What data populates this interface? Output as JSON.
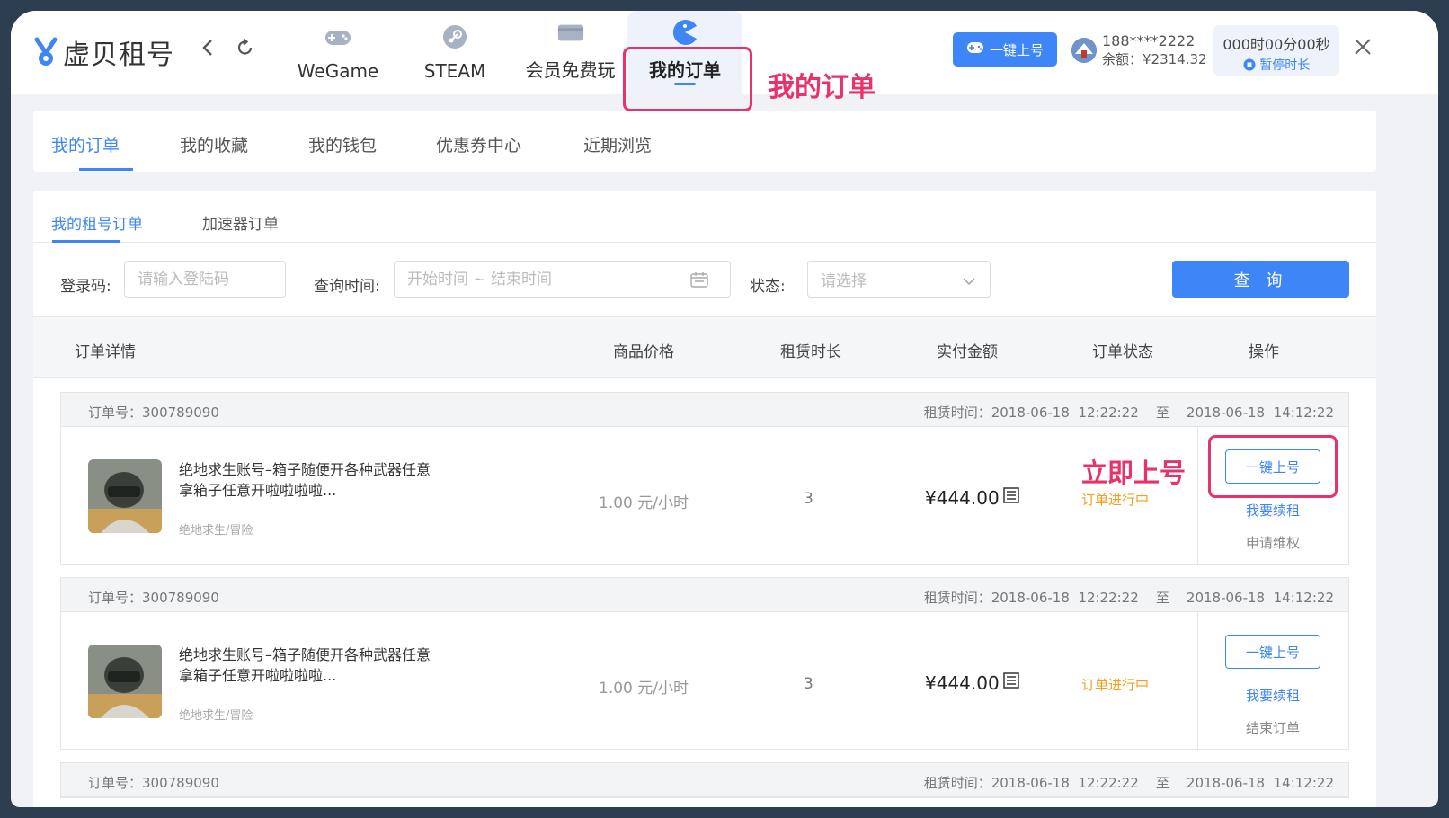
{
  "app": {
    "logo_text": "虚贝租号",
    "game_tabs": [
      {
        "label": "WeGame",
        "icon": "gamepad-icon"
      },
      {
        "label": "STEAM",
        "icon": "steam-icon"
      },
      {
        "label": "会员免费玩",
        "icon": "card-icon"
      },
      {
        "label": "我的订单",
        "icon": "pacman-icon",
        "active": true
      }
    ],
    "annotation_top": "我的订单",
    "login_button": "一键上号",
    "user": {
      "phone": "188****2222",
      "balance": "余额：¥2314.32"
    },
    "timer": {
      "time": "000时00分00秒",
      "pause": "暂停时长"
    }
  },
  "section_tabs": [
    "我的订单",
    "我的收藏",
    "我的钱包",
    "优惠券中心",
    "近期浏览"
  ],
  "sub_tabs": [
    "我的租号订单",
    "加速器订单"
  ],
  "filters": {
    "login_code_label": "登录码:",
    "login_code_placeholder": "请输入登陆码",
    "time_label": "查询时间:",
    "time_placeholder": "开始时间 ~ 结束时间",
    "status_label": "状态:",
    "status_placeholder": "请选择",
    "search_button": "查 询"
  },
  "table_headers": [
    "订单详情",
    "商品价格",
    "租赁时长",
    "实付金额",
    "订单状态",
    "操作"
  ],
  "orders": [
    {
      "order_no": "订单号：300789090",
      "rent_time": "租赁时间：2018-06-18  12:22:22    至    2018-06-18  14:12:22",
      "title": "绝地求生账号–箱子随便开各种武器任意拿箱子任意开啦啦啦啦...",
      "category": "绝地求生/冒险",
      "price": "1.00 元/小时",
      "duration": "3",
      "paid": "¥444.00",
      "status": "订单进行中",
      "primary_action": "一键上号",
      "link_action": "我要续租",
      "gray_action": "申请维权",
      "annotation": "立即上号"
    },
    {
      "order_no": "订单号：300789090",
      "rent_time": "租赁时间：2018-06-18  12:22:22    至    2018-06-18  14:12:22",
      "title": "绝地求生账号–箱子随便开各种武器任意拿箱子任意开啦啦啦啦...",
      "category": "绝地求生/冒险",
      "price": "1.00 元/小时",
      "duration": "3",
      "paid": "¥444.00",
      "status": "订单进行中",
      "primary_action": "一键上号",
      "link_action": "我要续租",
      "gray_action": "结束订单"
    },
    {
      "order_no": "订单号：300789090",
      "rent_time": "租赁时间：2018-06-18  12:22:22    至    2018-06-18  14:12:22"
    }
  ],
  "colors": {
    "accent": "#3e86f7",
    "highlight": "#e8326a",
    "status": "#f0a020"
  }
}
